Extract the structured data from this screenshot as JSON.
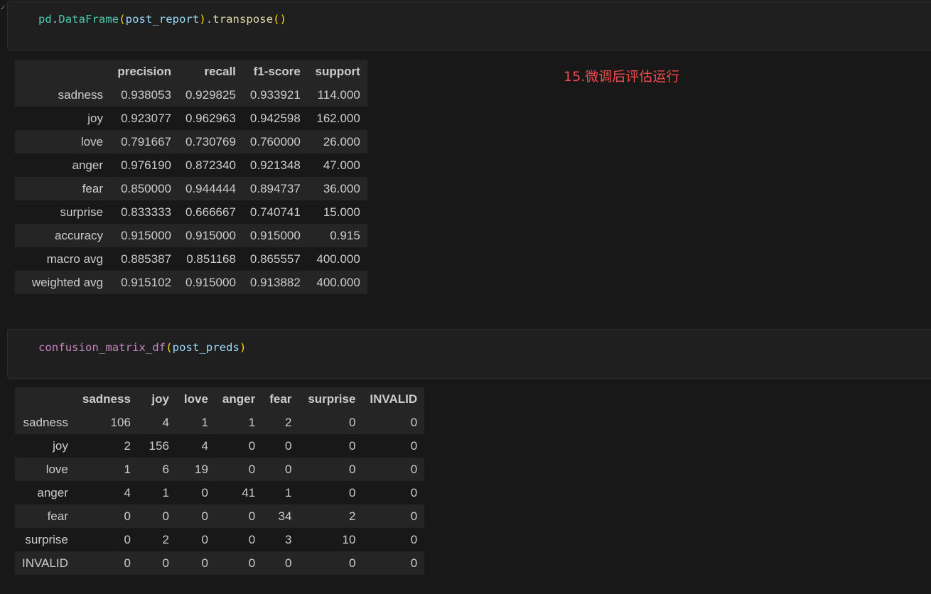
{
  "cell1": {
    "code": {
      "var": "pd",
      "cls": "DataFrame",
      "open": "(",
      "arg": "post_report",
      "close": ")",
      "method": "transpose",
      "call": "()"
    }
  },
  "annotation": "15.微调后评估运行",
  "report_table": {
    "columns": [
      "precision",
      "recall",
      "f1-score",
      "support"
    ],
    "rows": [
      {
        "label": "sadness",
        "values": [
          "0.938053",
          "0.929825",
          "0.933921",
          "114.000"
        ]
      },
      {
        "label": "joy",
        "values": [
          "0.923077",
          "0.962963",
          "0.942598",
          "162.000"
        ]
      },
      {
        "label": "love",
        "values": [
          "0.791667",
          "0.730769",
          "0.760000",
          "26.000"
        ]
      },
      {
        "label": "anger",
        "values": [
          "0.976190",
          "0.872340",
          "0.921348",
          "47.000"
        ]
      },
      {
        "label": "fear",
        "values": [
          "0.850000",
          "0.944444",
          "0.894737",
          "36.000"
        ]
      },
      {
        "label": "surprise",
        "values": [
          "0.833333",
          "0.666667",
          "0.740741",
          "15.000"
        ]
      },
      {
        "label": "accuracy",
        "values": [
          "0.915000",
          "0.915000",
          "0.915000",
          "0.915"
        ]
      },
      {
        "label": "macro avg",
        "values": [
          "0.885387",
          "0.851168",
          "0.865557",
          "400.000"
        ]
      },
      {
        "label": "weighted avg",
        "values": [
          "0.915102",
          "0.915000",
          "0.913882",
          "400.000"
        ]
      }
    ]
  },
  "cell2": {
    "code": {
      "fn": "confusion_matrix_df",
      "open": "(",
      "arg": "post_preds",
      "close": ")"
    }
  },
  "confusion_table": {
    "columns": [
      "sadness",
      "joy",
      "love",
      "anger",
      "fear",
      "surprise",
      "INVALID"
    ],
    "rows": [
      {
        "label": "sadness",
        "values": [
          "106",
          "4",
          "1",
          "1",
          "2",
          "0",
          "0"
        ]
      },
      {
        "label": "joy",
        "values": [
          "2",
          "156",
          "4",
          "0",
          "0",
          "0",
          "0"
        ]
      },
      {
        "label": "love",
        "values": [
          "1",
          "6",
          "19",
          "0",
          "0",
          "0",
          "0"
        ]
      },
      {
        "label": "anger",
        "values": [
          "4",
          "1",
          "0",
          "41",
          "1",
          "0",
          "0"
        ]
      },
      {
        "label": "fear",
        "values": [
          "0",
          "0",
          "0",
          "0",
          "34",
          "2",
          "0"
        ]
      },
      {
        "label": "surprise",
        "values": [
          "0",
          "2",
          "0",
          "0",
          "3",
          "10",
          "0"
        ]
      },
      {
        "label": "INVALID",
        "values": [
          "0",
          "0",
          "0",
          "0",
          "0",
          "0",
          "0"
        ]
      }
    ]
  }
}
